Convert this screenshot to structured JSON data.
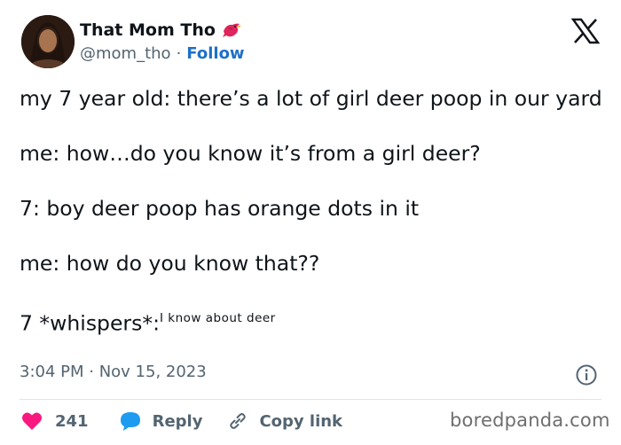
{
  "author": {
    "name": "That Mom Tho",
    "handle": "@mom_tho",
    "separator": "·",
    "follow_label": "Follow"
  },
  "tweet": {
    "line1": "my 7 year old: there’s a lot of girl deer poop in our yard",
    "line2": "me: how…do you know it’s from a girl deer?",
    "line3": "7: boy deer poop has orange dots in it",
    "line4": "me: how do you know that??",
    "line5_main": "7 *whispers*:",
    "line5_small": "I know about deer"
  },
  "meta": {
    "timestamp": "3:04 PM · Nov 15, 2023"
  },
  "actions": {
    "like_count": "241",
    "reply_label": "Reply",
    "copy_link_label": "Copy link"
  },
  "watermark": "boredpanda.com",
  "icons": {
    "bird": "red-bird-icon",
    "x_logo": "x-logo-icon",
    "info": "info-icon",
    "heart": "heart-icon",
    "reply": "speech-bubble-icon",
    "link": "link-icon"
  },
  "colors": {
    "heart": "#f91880",
    "reply_bubble": "#1d9bf0",
    "follow": "#1d70c9",
    "bird": "#e0245e"
  }
}
